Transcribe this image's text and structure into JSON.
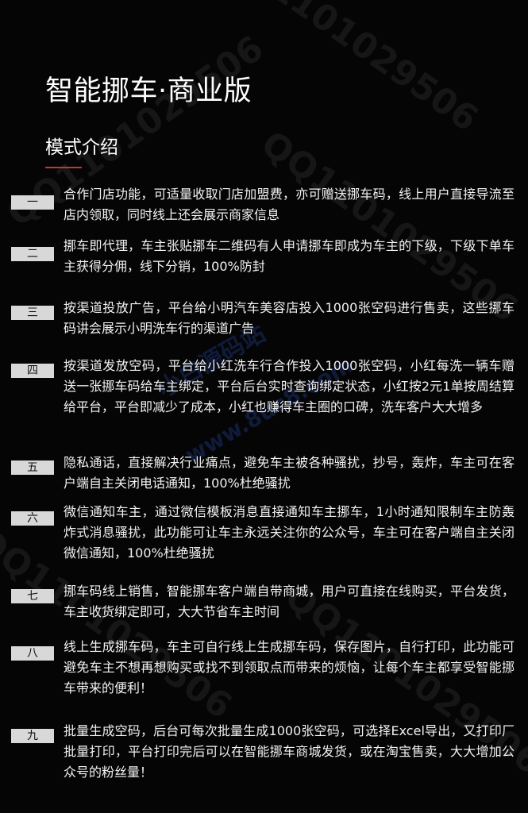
{
  "title": "智能挪车·商业版",
  "section_title": "模式介绍",
  "items": [
    {
      "badge": "一",
      "text": "合作门店功能，可适量收取门店加盟费，亦可赠送挪车码，线上用户直接导流至店内领取，同时线上还会展示商家信息"
    },
    {
      "badge": "二",
      "text": "挪车即代理，车主张贴挪车二维码有人申请挪车即成为车主的下级，下级下单车主获得分佣，线下分销，100%防封"
    },
    {
      "badge": "三",
      "text": "按渠道投放广告，平台给小明汽车美容店投入1000张空码进行售卖，这些挪车码讲会展示小明洗车行的渠道广告"
    },
    {
      "badge": "四",
      "text": "按渠道发放空码，平台给小红洗车行合作投入1000张空码，小红每洗一辆车赠送一张挪车码给车主绑定，平台后台实时查询绑定状态，小红按2元1单按周结算给平台，平台即减少了成本，小红也赚得车主圈的口碑，洗车客户大大增多"
    },
    {
      "badge": "五",
      "text": "隐私通话，直接解决行业痛点，避免车主被各种骚扰，抄号，轰炸，车主可在客户端自主关闭电话通知，100%杜绝骚扰"
    },
    {
      "badge": "六",
      "text": "微信通知车主，通过微信模板消息直接通知车主挪车，1小时通知限制车主防轰炸式消息骚扰，此功能可让车主永远关注你的公众号，车主可在客户端自主关闭微信通知，100%杜绝骚扰"
    },
    {
      "badge": "七",
      "text": "挪车码线上销售，智能挪车客户端自带商城，用户可直接在线购买，平台发货，车主收货绑定即可，大大节省车主时间"
    },
    {
      "badge": "八",
      "text": "线上生成挪车码，车主可自行线上生成挪车码，保存图片，自行打印，此功能可避免车主不想再想购买或找不到领取点而带来的烦恼，让每个车主都享受智能挪车带来的便利！"
    },
    {
      "badge": "九",
      "text": "批量生成空码，后台可每次批量生成1000张空码，可选择Excel导出，又打印厂批量打印，平台打印完后可以在智能挪车商城发货，或在淘宝售卖，大大增加公众号的粉丝量！"
    }
  ],
  "watermark": "QQ1101029506",
  "watermark_center_1": "小白源码站",
  "watermark_center_2": "www.8uc8.com",
  "colors": {
    "background": "#050505",
    "accent": "#c8352c",
    "badge_bg": "#d8d8d8"
  }
}
